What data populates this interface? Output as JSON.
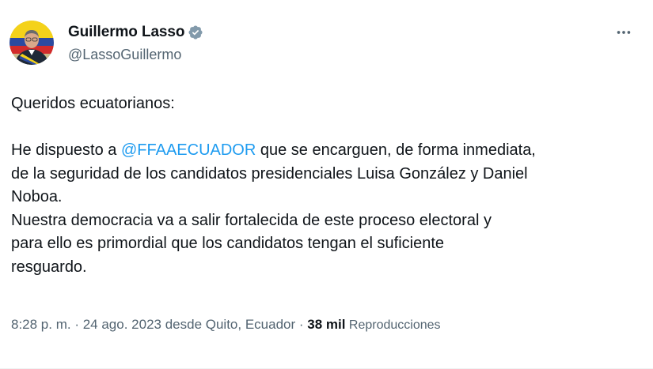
{
  "author": {
    "display_name": "Guillermo Lasso",
    "handle": "@LassoGuillermo",
    "verified": true,
    "avatar_icon": "profile-photo"
  },
  "tweet": {
    "greeting": "Queridos ecuatorianos:",
    "para1_before_mention": "He dispuesto a ",
    "mention": "@FFAAECUADOR",
    "para1_after_mention": " que se encarguen, de forma inmediata,",
    "line2": "de la seguridad de los candidatos presidenciales Luisa González y Daniel",
    "line3": "Noboa.",
    "line4": "Nuestra democracia va a salir fortalecida de este proceso electoral y",
    "line5": "para ello es primordial que los candidatos tengan el suficiente",
    "line6": "resguardo."
  },
  "meta": {
    "time": "8:28 p. m.",
    "sep1": " · ",
    "date": "24 ago. 2023",
    "location": " desde Quito, Ecuador",
    "sep2": " · ",
    "views_count": "38 mil",
    "views_label": " Reproducciones"
  },
  "colors": {
    "mention": "#1d9bf0",
    "verified_badge": "#829aab",
    "secondary_text": "#536471",
    "primary_text": "#0f1419"
  },
  "icons": {
    "more": "more-horizontal-icon",
    "verified": "verified-badge-icon"
  }
}
